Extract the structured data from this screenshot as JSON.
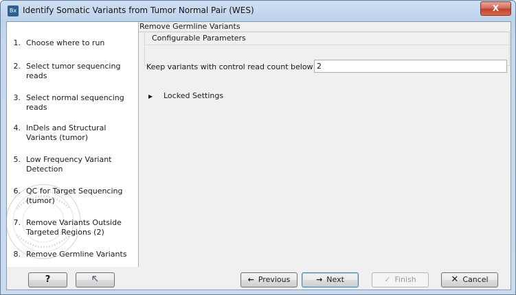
{
  "window": {
    "title": "Identify Somatic Variants from Tumor Normal Pair (WES)",
    "app_icon_text": "Bx",
    "close_glyph": "X"
  },
  "sidebar": {
    "steps": [
      {
        "num": "1.",
        "label": "Choose where to run"
      },
      {
        "num": "2.",
        "label": "Select tumor sequencing reads"
      },
      {
        "num": "3.",
        "label": "Select normal sequencing reads"
      },
      {
        "num": "4.",
        "label": "InDels and Structural Variants (tumor)"
      },
      {
        "num": "5.",
        "label": "Low Frequency Variant Detection"
      },
      {
        "num": "6.",
        "label": "QC for Target Sequencing (tumor)"
      },
      {
        "num": "7.",
        "label": "Remove Variants Outside Targeted Regions (2)"
      },
      {
        "num": "8.",
        "label": "Remove Germline Variants"
      }
    ]
  },
  "main": {
    "panel_title": "Remove Germline Variants",
    "group_title": "Configurable Parameters",
    "param_label": "Keep variants with control read count below",
    "param_value": "2",
    "locked_label": "Locked Settings"
  },
  "footer": {
    "help_label": "?",
    "previous_label": "Previous",
    "next_label": "Next",
    "finish_label": "Finish",
    "cancel_label": "Cancel"
  }
}
